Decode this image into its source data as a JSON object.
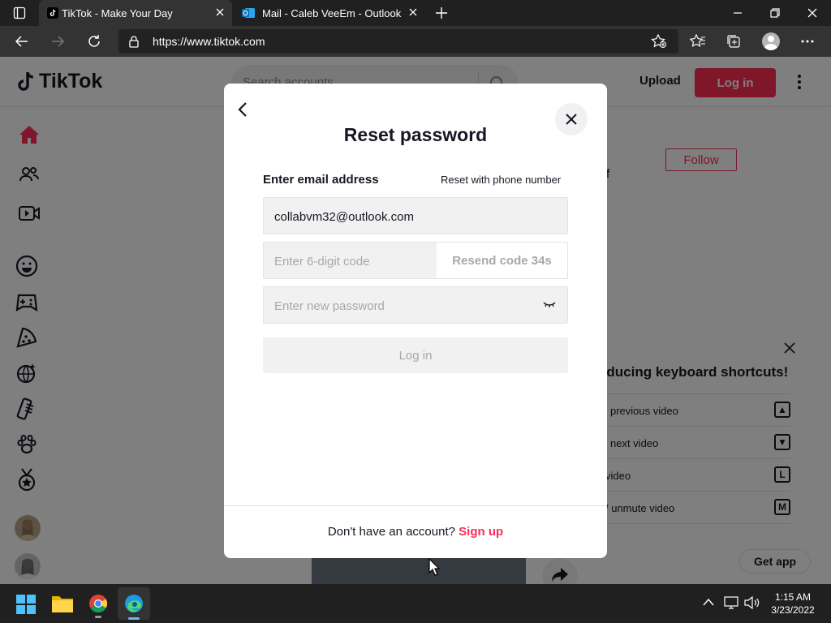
{
  "browser": {
    "tabs": [
      {
        "title": "TikTok - Make Your Day",
        "icon": "tiktok-icon"
      },
      {
        "title": "Mail - Caleb VeeEm - Outlook",
        "icon": "outlook-icon"
      }
    ],
    "url": "https://www.tiktok.com"
  },
  "tiktok": {
    "logo_text": "TikTok",
    "search_placeholder": "Search accounts",
    "upload_label": "Upload",
    "login_label": "Log in",
    "follow_label": "Follow",
    "partial_text": "f",
    "get_app_label": "Get app"
  },
  "shortcuts": {
    "title": "oducing keyboard shortcuts!",
    "items": [
      {
        "label": "previous video",
        "key": "▲"
      },
      {
        "label": "next video",
        "key": "▼"
      },
      {
        "label": "video",
        "key": "L"
      },
      {
        "label": "/ unmute video",
        "key": "M"
      }
    ]
  },
  "modal": {
    "title": "Reset password",
    "email_label": "Enter email address",
    "phone_link": "Reset with phone number",
    "email_value": "collabvm32@outlook.com",
    "code_placeholder": "Enter 6-digit code",
    "resend_label": "Resend code 34s",
    "password_placeholder": "Enter new password",
    "login_button": "Log in",
    "footer_text": "Don't have an account?",
    "signup_link": "Sign up"
  },
  "taskbar": {
    "time": "1:15 AM",
    "date": "3/23/2022"
  },
  "colors": {
    "brand": "#fe2c55",
    "modal_bg": "#ffffff",
    "taskbar_bg": "#202020"
  }
}
